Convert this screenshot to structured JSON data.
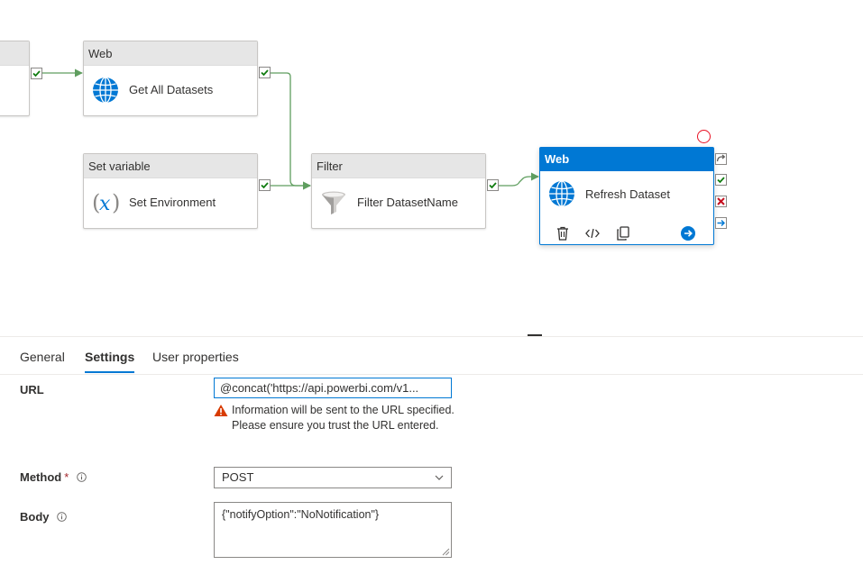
{
  "canvas": {
    "activities": [
      {
        "id": "partial",
        "type": "",
        "label": ""
      },
      {
        "id": "get-all-datasets",
        "type": "Web",
        "label": "Get All Datasets",
        "icon": "globe-icon"
      },
      {
        "id": "set-environment",
        "type": "Set variable",
        "label": "Set Environment",
        "icon": "variable-icon"
      },
      {
        "id": "filter-datasetname",
        "type": "Filter",
        "label": "Filter DatasetName",
        "icon": "filter-funnel-icon"
      },
      {
        "id": "refresh-dataset",
        "type": "Web",
        "label": "Refresh Dataset",
        "icon": "globe-icon",
        "selected": true
      }
    ],
    "node_actions": [
      "delete-icon",
      "code-icon",
      "copy-icon",
      "go-arrow-icon"
    ],
    "ports": [
      "skip-icon",
      "success-check-icon",
      "failure-x-icon",
      "completion-arrow-icon"
    ],
    "colors": {
      "accent": "#0078d4",
      "success": "#107c10",
      "failure": "#c50f1f",
      "edge": "#5f9e5f",
      "warning": "#d83b01"
    }
  },
  "panel": {
    "tabs": [
      {
        "label": "General",
        "active": false
      },
      {
        "label": "Settings",
        "active": true
      },
      {
        "label": "User properties",
        "active": false
      }
    ],
    "fields": {
      "url": {
        "label": "URL",
        "value": "@concat('https://api.powerbi.com/v1...",
        "warning": "Information will be sent to the URL specified. Please ensure you trust the URL entered."
      },
      "method": {
        "label": "Method",
        "required_mark": "*",
        "value": "POST"
      },
      "body": {
        "label": "Body",
        "value": "{\"notifyOption\":\"NoNotification\"}"
      }
    }
  }
}
